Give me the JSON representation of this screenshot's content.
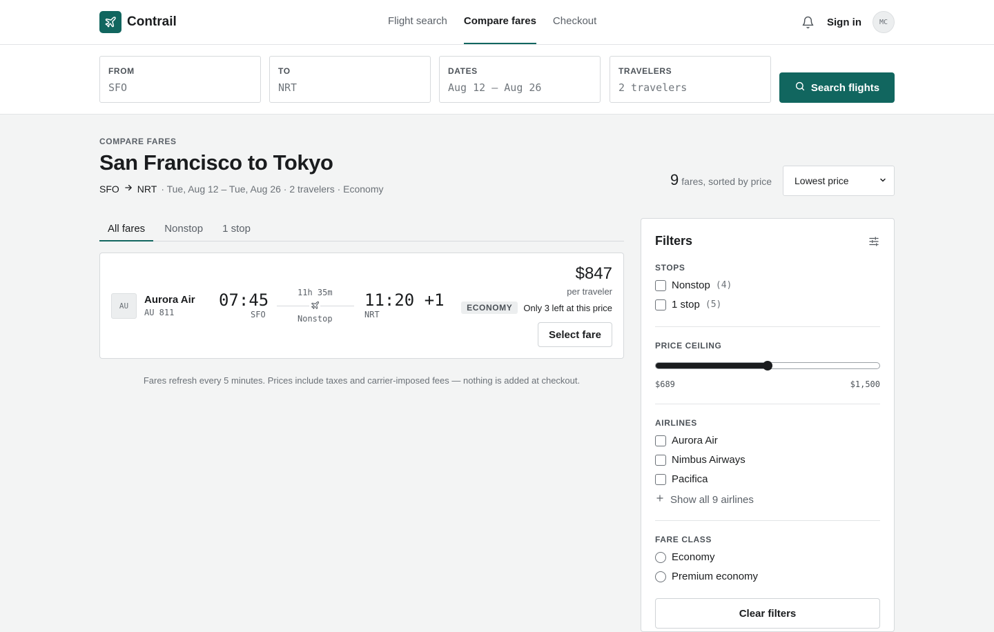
{
  "app": {
    "name": "Contrail",
    "logo_icon": "plane-icon"
  },
  "nav": {
    "items": [
      {
        "label": "Flight search",
        "active": false
      },
      {
        "label": "Compare fares",
        "active": true
      },
      {
        "label": "Checkout",
        "active": false
      }
    ]
  },
  "header": {
    "sign_in": "Sign in",
    "avatar_initials": "MC",
    "bell_icon": "bell-icon"
  },
  "search": {
    "from": {
      "label": "FROM",
      "value": "SFO"
    },
    "to": {
      "label": "TO",
      "value": "NRT"
    },
    "dates": {
      "label": "DATES",
      "value": "Aug 12 – Aug 26"
    },
    "travelers": {
      "label": "TRAVELERS",
      "value": "2 travelers"
    },
    "button": "Search flights"
  },
  "page": {
    "eyebrow": "COMPARE FARES",
    "title": "San Francisco to Tokyo",
    "origin": "SFO",
    "destination": "NRT",
    "trip_details": "· Tue, Aug 12 – Tue, Aug 26 · 2 travelers · Economy",
    "fare_count": "9",
    "fare_count_text": "fares, sorted by price",
    "sort_value": "Lowest price"
  },
  "tabs": [
    {
      "label": "All fares",
      "active": true
    },
    {
      "label": "Nonstop",
      "active": false
    },
    {
      "label": "1 stop",
      "active": false
    }
  ],
  "fare": {
    "airline_code": "AU",
    "airline": "Aurora Air",
    "flight_no": "AU 811",
    "dep_time": "07:45",
    "dep_airport": "SFO",
    "duration": "11h 35m",
    "stops": "Nonstop",
    "arr_time": "11:20 +1",
    "arr_airport": "NRT",
    "price": "$847",
    "price_unit": "per traveler",
    "fare_class": "ECONOMY",
    "scarcity": "Only 3 left at this price",
    "select_label": "Select fare"
  },
  "refresh_note": "Fares refresh every 5 minutes. Prices include taxes and carrier-imposed fees — nothing is added at checkout.",
  "filters": {
    "title": "Filters",
    "stops": {
      "label": "STOPS",
      "options": [
        {
          "label": "Nonstop",
          "count": "(4)",
          "checked": false
        },
        {
          "label": "1 stop",
          "count": "(5)",
          "checked": false
        }
      ]
    },
    "price": {
      "label": "PRICE CEILING",
      "min_label": "$689",
      "max_label": "$1,500",
      "level": 0.5
    },
    "airlines": {
      "label": "AIRLINES",
      "options": [
        {
          "label": "Aurora Air",
          "checked": false
        },
        {
          "label": "Nimbus Airways",
          "checked": false
        },
        {
          "label": "Pacifica",
          "checked": false
        }
      ],
      "show_all": "Show all 9 airlines"
    },
    "fare_class": {
      "label": "FARE CLASS",
      "options": [
        {
          "label": "Economy",
          "selected": false
        },
        {
          "label": "Premium economy",
          "selected": false
        }
      ]
    },
    "clear": "Clear filters"
  },
  "colors": {
    "accent": "#11665f",
    "background": "#f3f4f4",
    "text": "#1a1c1e"
  }
}
